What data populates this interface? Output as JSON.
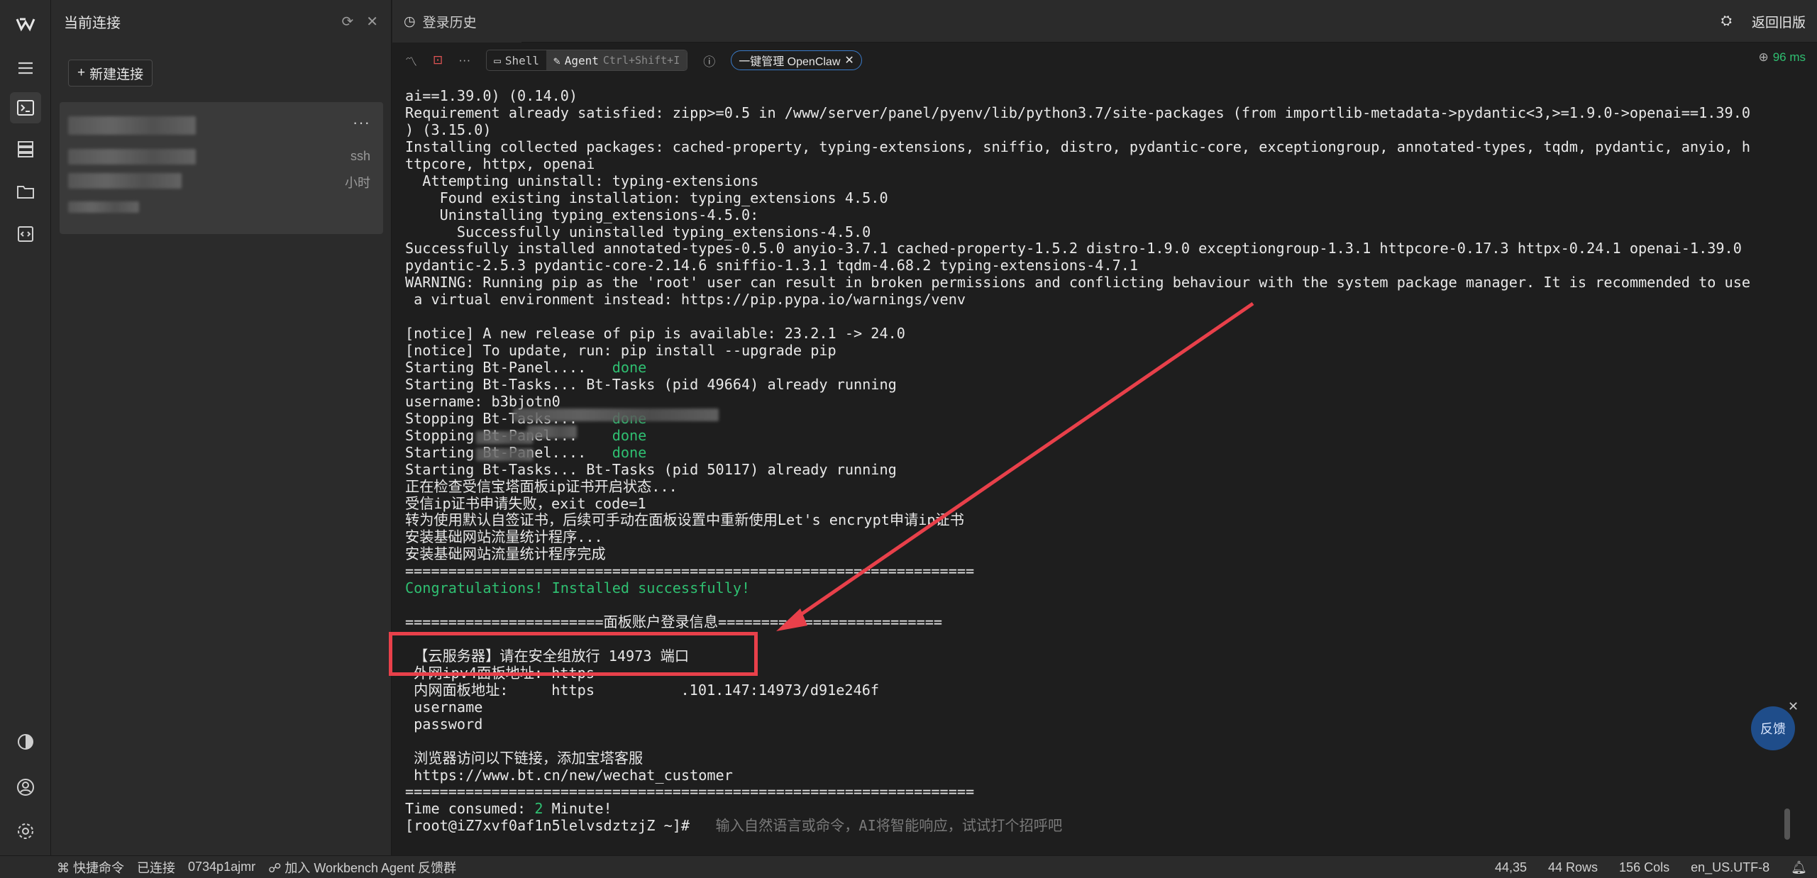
{
  "rail": {
    "items": [
      {
        "icon": "logo-icon"
      },
      {
        "icon": "menu-icon"
      },
      {
        "icon": "terminal-icon"
      },
      {
        "icon": "server-list-icon"
      },
      {
        "icon": "folder-icon"
      },
      {
        "icon": "code-file-icon"
      }
    ],
    "bottom": [
      {
        "icon": "theme-icon"
      },
      {
        "icon": "user-icon"
      },
      {
        "icon": "settings-icon"
      }
    ]
  },
  "conn_panel": {
    "title": "当前连接",
    "new_button": "新建连接",
    "card": {
      "more": "···",
      "proto": "ssh",
      "time": "小时"
    }
  },
  "tabs": {
    "history": "登录历史",
    "terminal_prefix": ">_"
  },
  "header_right": {
    "back_label": "返回旧版"
  },
  "toolbar": {
    "shell": "Shell",
    "agent": "Agent",
    "agent_shortcut": "Ctrl+Shift+I",
    "openclaw_chip": "一键管理 OpenClaw",
    "latency": "96 ms"
  },
  "terminal": {
    "lines": [
      {
        "t": "ai==1.39.0) (0.14.0)"
      },
      {
        "t": "Requirement already satisfied: zipp>=0.5 in /www/server/panel/pyenv/lib/python3.7/site-packages (from importlib-metadata->pydantic<3,>=1.9.0->openai==1.39.0"
      },
      {
        "t": ") (3.15.0)"
      },
      {
        "t": "Installing collected packages: cached-property, typing-extensions, sniffio, distro, pydantic-core, exceptiongroup, annotated-types, tqdm, pydantic, anyio, h"
      },
      {
        "t": "ttpcore, httpx, openai"
      },
      {
        "t": "  Attempting uninstall: typing-extensions"
      },
      {
        "t": "    Found existing installation: typing_extensions 4.5.0"
      },
      {
        "t": "    Uninstalling typing_extensions-4.5.0:"
      },
      {
        "t": "      Successfully uninstalled typing_extensions-4.5.0"
      },
      {
        "t": "Successfully installed annotated-types-0.5.0 anyio-3.7.1 cached-property-1.5.2 distro-1.9.0 exceptiongroup-1.3.1 httpcore-0.17.3 httpx-0.24.1 openai-1.39.0"
      },
      {
        "t": "pydantic-2.5.3 pydantic-core-2.14.6 sniffio-1.3.1 tqdm-4.68.2 typing-extensions-4.7.1"
      },
      {
        "t": "WARNING: Running pip as the 'root' user can result in broken permissions and conflicting behaviour with the system package manager. It is recommended to use"
      },
      {
        "t": " a virtual environment instead: https://pip.pypa.io/warnings/venv"
      },
      {
        "t": ""
      },
      {
        "t": "[notice] A new release of pip is available: 23.2.1 -> 24.0"
      },
      {
        "t": "[notice] To update, run: pip install --upgrade pip"
      },
      {
        "t": "Starting Bt-Panel....   ",
        "g": "done"
      },
      {
        "t": "Starting Bt-Tasks... Bt-Tasks (pid 49664) already running"
      },
      {
        "t": "username: b3bjotn0"
      },
      {
        "t": "Stopping Bt-Tasks...    ",
        "g": "done"
      },
      {
        "t": "Stopping Bt-Panel...    ",
        "g": "done"
      },
      {
        "t": "Starting Bt-Panel....   ",
        "g": "done"
      },
      {
        "t": "Starting Bt-Tasks... Bt-Tasks (pid 50117) already running"
      },
      {
        "t": "正在检查受信宝塔面板ip证书开启状态..."
      },
      {
        "t": "受信ip证书申请失败，exit code=1"
      },
      {
        "t": "转为使用默认自签证书，后续可手动在面板设置中重新使用Let's encrypt申请ip证书"
      },
      {
        "t": "安装基础网站流量统计程序..."
      },
      {
        "t": "安装基础网站流量统计程序完成"
      },
      {
        "t": "=================================================================="
      },
      {
        "t": "",
        "g": "Congratulations! Installed successfully!"
      },
      {
        "t": ""
      },
      {
        "t": "=======================面板账户登录信息=========================="
      },
      {
        "t": ""
      },
      {
        "t": " 【云服务器】请在安全组放行 14973 端口"
      },
      {
        "t": " 外网ipv4面板地址: https"
      },
      {
        "t": " 内网面板地址:     https          .101.147:14973/d91e246f"
      },
      {
        "t": " username"
      },
      {
        "t": " password"
      },
      {
        "t": ""
      },
      {
        "t": " 浏览器访问以下链接，添加宝塔客服"
      },
      {
        "t": " https://www.bt.cn/new/wechat_customer"
      },
      {
        "t": "=================================================================="
      },
      {
        "t": "Time consumed: ",
        "g": "2",
        "s": " Minute!"
      },
      {
        "t": "[root@iZ7xvf0af1n5lelvsdztzjZ ~]#   ",
        "h": "输入自然语言或命令，AI将智能响应，试试打个招呼吧"
      }
    ]
  },
  "feedback": {
    "label": "反馈"
  },
  "statusbar": {
    "shortcuts": "快捷命令",
    "connected": "已连接",
    "session": "0734p1ajmr",
    "community": "加入 Workbench Agent 反馈群",
    "cursor": "44,35",
    "rows": "44 Rows",
    "cols": "156 Cols",
    "encoding": "en_US.UTF-8"
  }
}
